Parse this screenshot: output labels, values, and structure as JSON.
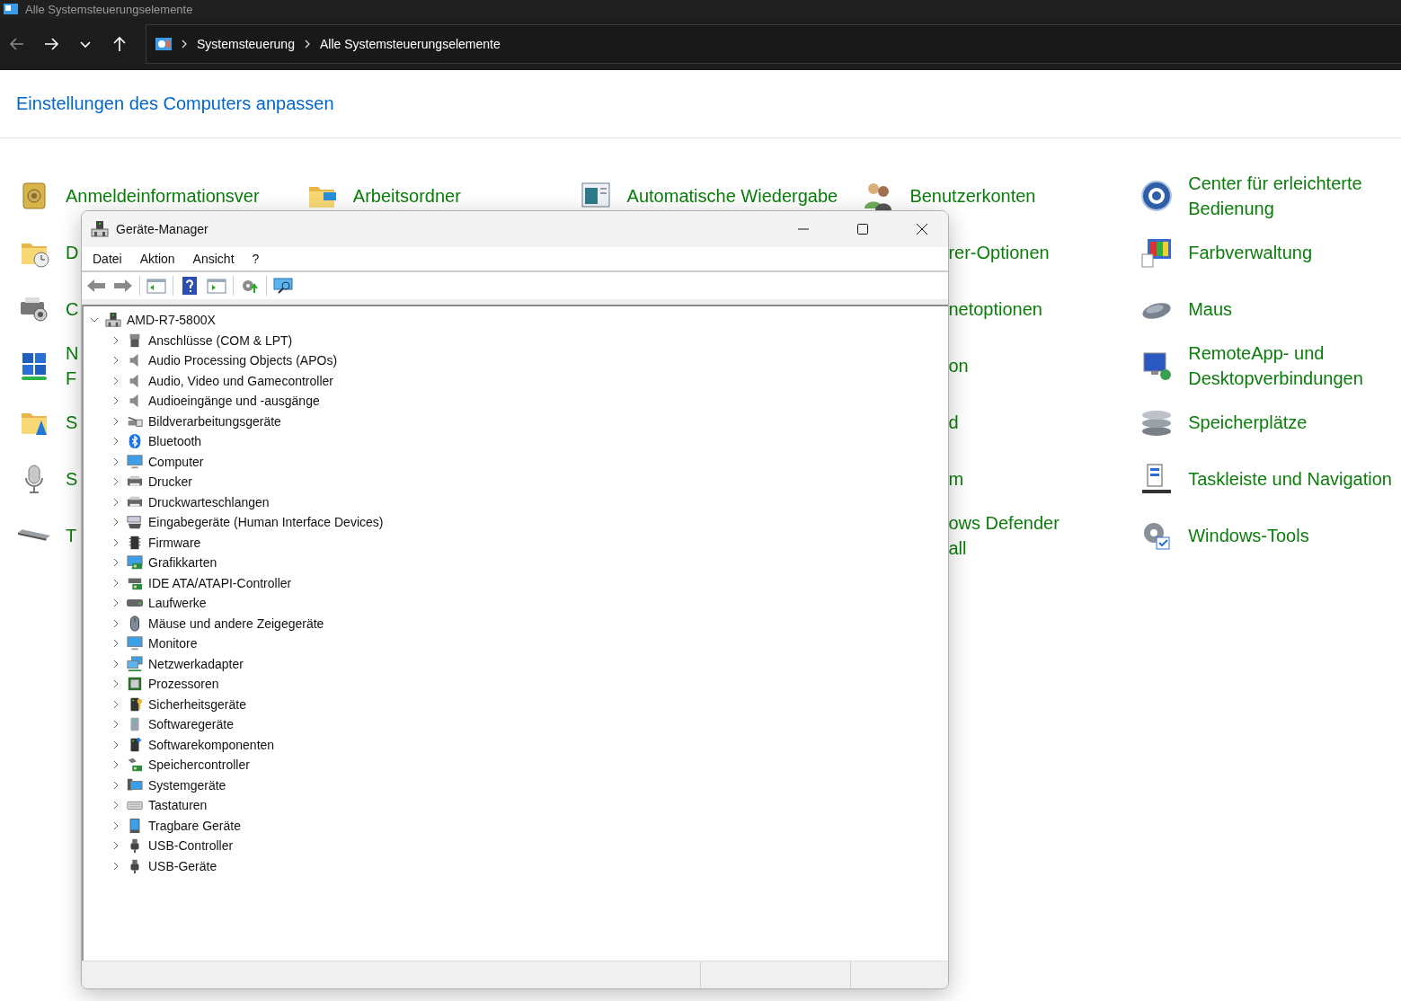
{
  "explorer": {
    "title": "Alle Systemsteuerungselemente",
    "breadcrumb": [
      "Systemsteuerung",
      "Alle Systemsteuerungselemente"
    ]
  },
  "control_panel": {
    "heading": "Einstellungen des Computers anpassen",
    "columns": [
      [
        {
          "lines": [
            "Anmeldeinformationsver"
          ],
          "covered": false
        },
        {
          "lines": [
            "D"
          ],
          "covered": false
        },
        {
          "lines": [
            "C"
          ],
          "covered": false
        },
        {
          "lines": [
            "N",
            "F"
          ],
          "covered": false
        },
        {
          "lines": [
            "S"
          ],
          "covered": false
        },
        {
          "lines": [
            "S"
          ],
          "covered": false
        },
        {
          "lines": [
            "T"
          ],
          "covered": false
        }
      ],
      [
        {
          "lines": [
            "Arbeitsordner"
          ],
          "covered": false
        }
      ],
      [
        {
          "lines": [
            "Automatische Wiedergabe"
          ],
          "covered": false
        }
      ],
      [
        {
          "lines": [
            "Benutzerkonten"
          ],
          "covered": false
        },
        {
          "lines": [
            "rer-Optionen"
          ],
          "covered": true
        },
        {
          "lines": [
            "netoptionen"
          ],
          "covered": true
        },
        {
          "lines": [
            "on"
          ],
          "covered": true
        },
        {
          "lines": [
            "d"
          ],
          "covered": true
        },
        {
          "lines": [
            "m"
          ],
          "covered": true
        },
        {
          "lines": [
            "ows Defender",
            "all"
          ],
          "covered": true
        }
      ],
      [
        {
          "lines": [
            "Center für erleichterte",
            "Bedienung"
          ],
          "covered": false
        },
        {
          "lines": [
            "Farbverwaltung"
          ],
          "covered": false
        },
        {
          "lines": [
            "Maus"
          ],
          "covered": false
        },
        {
          "lines": [
            "RemoteApp- und",
            "Desktopverbindungen"
          ],
          "covered": false
        },
        {
          "lines": [
            "Speicherplätze"
          ],
          "covered": false
        },
        {
          "lines": [
            "Taskleiste und Navigation"
          ],
          "covered": false
        },
        {
          "lines": [
            "Windows-Tools"
          ],
          "covered": false
        }
      ]
    ]
  },
  "device_manager": {
    "title": "Geräte-Manager",
    "menu": [
      "Datei",
      "Aktion",
      "Ansicht",
      "?"
    ],
    "tree": {
      "label": "AMD-R7-5800X",
      "expanded": true,
      "children": [
        {
          "label": "Anschlüsse (COM & LPT)",
          "expanded": false
        },
        {
          "label": "Audio Processing Objects (APOs)",
          "expanded": false
        },
        {
          "label": "Audio, Video und Gamecontroller",
          "expanded": false
        },
        {
          "label": "Audioeingänge und -ausgänge",
          "expanded": false
        },
        {
          "label": "Bildverarbeitungsgeräte",
          "expanded": false
        },
        {
          "label": "Bluetooth",
          "expanded": false
        },
        {
          "label": "Computer",
          "expanded": false
        },
        {
          "label": "Drucker",
          "expanded": false
        },
        {
          "label": "Druckwarteschlangen",
          "expanded": false
        },
        {
          "label": "Eingabegeräte (Human Interface Devices)",
          "expanded": false
        },
        {
          "label": "Firmware",
          "expanded": false
        },
        {
          "label": "Grafikkarten",
          "expanded": false
        },
        {
          "label": "IDE ATA/ATAPI-Controller",
          "expanded": false
        },
        {
          "label": "Laufwerke",
          "expanded": false
        },
        {
          "label": "Mäuse und andere Zeigegeräte",
          "expanded": false
        },
        {
          "label": "Monitore",
          "expanded": false
        },
        {
          "label": "Netzwerkadapter",
          "expanded": false
        },
        {
          "label": "Prozessoren",
          "expanded": false
        },
        {
          "label": "Sicherheitsgeräte",
          "expanded": false
        },
        {
          "label": "Softwaregeräte",
          "expanded": false
        },
        {
          "label": "Softwarekomponenten",
          "expanded": false
        },
        {
          "label": "Speichercontroller",
          "expanded": false
        },
        {
          "label": "Systemgeräte",
          "expanded": false
        },
        {
          "label": "Tastaturen",
          "expanded": false
        },
        {
          "label": "Tragbare Geräte",
          "expanded": false
        },
        {
          "label": "USB-Controller",
          "expanded": false
        },
        {
          "label": "USB-Geräte",
          "expanded": false
        }
      ]
    }
  }
}
